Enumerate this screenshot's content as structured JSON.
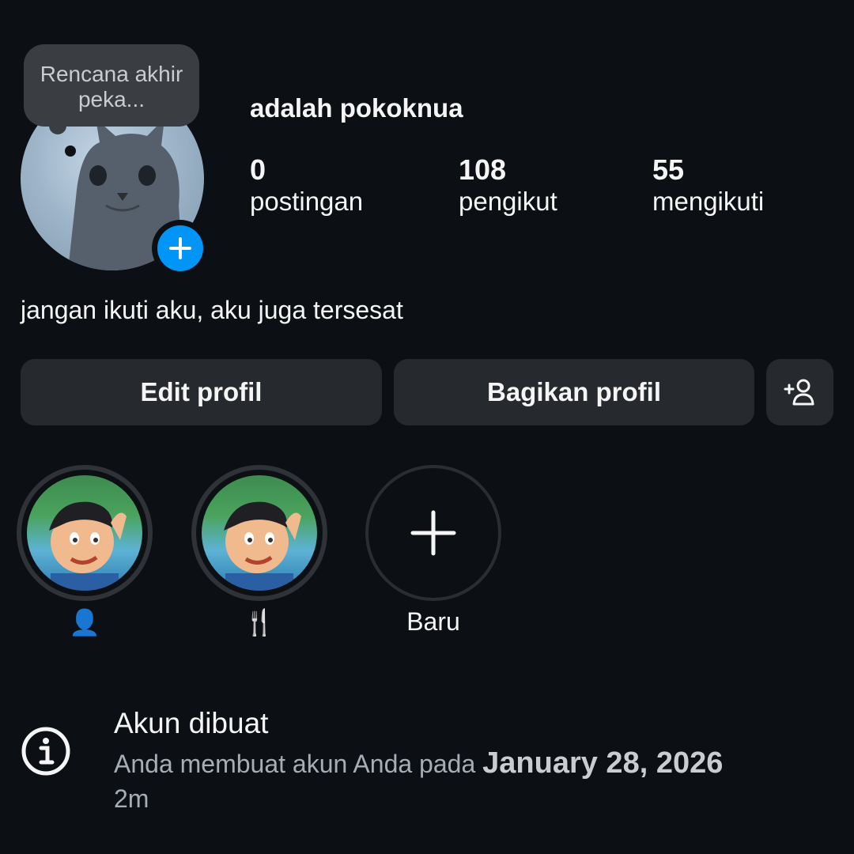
{
  "profile": {
    "note": "Rencana akhir peka...",
    "username": "adalah pokoknua",
    "bio": "jangan ikuti aku, aku juga tersesat",
    "add_story_icon": "plus-icon"
  },
  "stats": [
    {
      "value": "0",
      "label": "postingan"
    },
    {
      "value": "108",
      "label": "pengikut"
    },
    {
      "value": "55",
      "label": "mengikuti"
    }
  ],
  "actions": {
    "edit_label": "Edit profil",
    "share_label": "Bagikan profil",
    "add_friend_icon": "add-person-icon"
  },
  "highlights": [
    {
      "label": "👤"
    },
    {
      "label": "🍴"
    },
    {
      "label": "Baru"
    }
  ],
  "account_info": {
    "title": "Akun dibuat",
    "text_prefix": "Anda membuat akun Anda pada",
    "date": "January 28, 2026",
    "time_ago": "2m"
  },
  "colors": {
    "background": "#0c1014",
    "button": "#26292e",
    "accent": "#0095f6"
  }
}
